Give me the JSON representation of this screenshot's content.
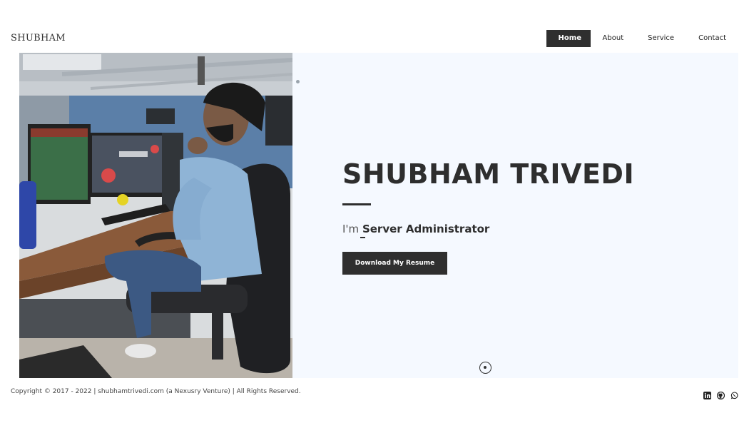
{
  "brand": {
    "logo": "SHUBHAM"
  },
  "nav": {
    "items": [
      {
        "label": "Home",
        "active": true
      },
      {
        "label": "About"
      },
      {
        "label": "Service"
      },
      {
        "label": "Contact"
      }
    ]
  },
  "hero": {
    "name": "SHUBHAM TRIVEDI",
    "role_prefix": "I'm",
    "role": "Server Administrator",
    "resume_button": "Download My Resume"
  },
  "footer": {
    "copyright": "Copyright © 2017 - 2022 | shubhamtrivedi.com (a Nexusry Venture) | All Rights Reserved."
  },
  "social_icons": [
    "linkedin-icon",
    "github-icon",
    "whatsapp-icon"
  ],
  "colors": {
    "dark": "#2f2f2f",
    "hero_bg": "#f5f9ff"
  }
}
